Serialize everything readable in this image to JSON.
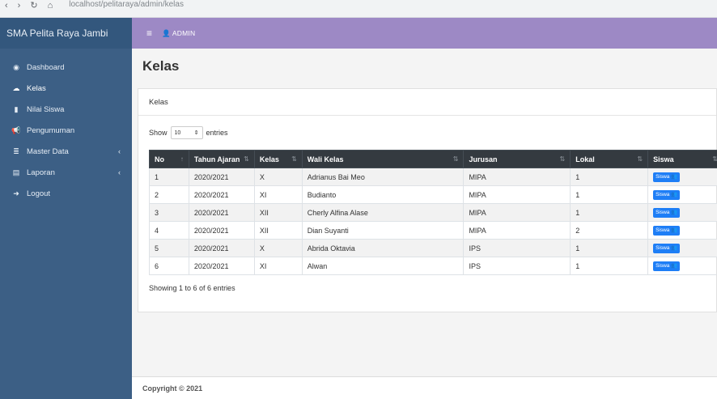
{
  "browser": {
    "url": "localhost/pelitaraya/admin/kelas",
    "back": "‹",
    "forward": "›",
    "reload": "↻",
    "home": "⌂"
  },
  "sidebar": {
    "brand": "SMA Pelita Raya Jambi",
    "items": [
      {
        "label": "Dashboard",
        "icon": "dashboard-icon",
        "glyph": "◉"
      },
      {
        "label": "Kelas",
        "icon": "cloud-icon",
        "glyph": "☁"
      },
      {
        "label": "Nilai Siswa",
        "icon": "file-icon",
        "glyph": "▮"
      },
      {
        "label": "Pengumuman",
        "icon": "bullhorn-icon",
        "glyph": "📢"
      },
      {
        "label": "Master Data",
        "icon": "database-icon",
        "glyph": "≣",
        "caret": "‹"
      },
      {
        "label": "Laporan",
        "icon": "print-icon",
        "glyph": "▤",
        "caret": "‹"
      },
      {
        "label": "Logout",
        "icon": "logout-icon",
        "glyph": "➜"
      }
    ]
  },
  "topbar": {
    "menu_glyph": "≡",
    "admin_glyph": "👤",
    "admin_label": "ADMIN"
  },
  "main": {
    "title": "Kelas",
    "card_header": "Kelas",
    "show_label": "Show",
    "entries_value": "10",
    "entries_label": "entries",
    "columns": [
      "No",
      "Tahun Ajaran",
      "Kelas",
      "Wali Kelas",
      "Jurusan",
      "Lokal",
      "Siswa"
    ],
    "rows": [
      {
        "no": "1",
        "tahun": "2020/2021",
        "kelas": "X",
        "wali": "Adrianus Bai Meo",
        "jurusan": "MIPA",
        "lokal": "1",
        "siswa": "Siswa 👥"
      },
      {
        "no": "2",
        "tahun": "2020/2021",
        "kelas": "XI",
        "wali": "Budianto",
        "jurusan": "MIPA",
        "lokal": "1",
        "siswa": "Siswa 👥"
      },
      {
        "no": "3",
        "tahun": "2020/2021",
        "kelas": "XII",
        "wali": "Cherly Alfina Alase",
        "jurusan": "MIPA",
        "lokal": "1",
        "siswa": "Siswa 👥"
      },
      {
        "no": "4",
        "tahun": "2020/2021",
        "kelas": "XII",
        "wali": "Dian Suyanti",
        "jurusan": "MIPA",
        "lokal": "2",
        "siswa": "Siswa 👥"
      },
      {
        "no": "5",
        "tahun": "2020/2021",
        "kelas": "X",
        "wali": "Abrida Oktavia",
        "jurusan": "IPS",
        "lokal": "1",
        "siswa": "Siswa 👥"
      },
      {
        "no": "6",
        "tahun": "2020/2021",
        "kelas": "XI",
        "wali": "Alwan",
        "jurusan": "IPS",
        "lokal": "1",
        "siswa": "Siswa 👥"
      }
    ],
    "showing": "Showing 1 to 6 of 6 entries"
  },
  "footer": "Copyright © 2021"
}
